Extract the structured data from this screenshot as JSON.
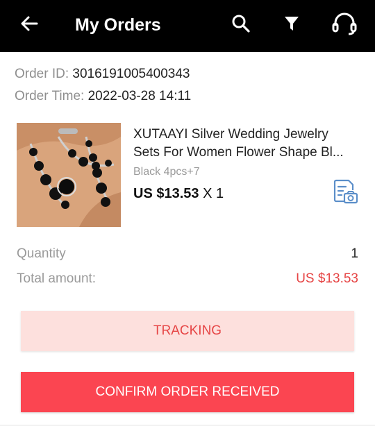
{
  "header": {
    "title": "My Orders",
    "back_icon": "arrow-left-icon",
    "actions": [
      "search-icon",
      "filter-icon",
      "headset-icon"
    ]
  },
  "order": {
    "id_label": "Order ID:",
    "id_value": "3016191005400343",
    "time_label": "Order Time:",
    "time_value": "2022-03-28 14:11"
  },
  "product": {
    "title_line1": "XUTAAYI  Silver Wedding Jewelry",
    "title_line2": "Sets For Women Flower Shape Bl...",
    "variant": "Black 4pcs+7",
    "price": "US $13.53",
    "multiplier": "X 1"
  },
  "summary": {
    "quantity_label": "Quantity",
    "quantity_value": "1",
    "total_label": "Total amount:",
    "total_value": "US $13.53"
  },
  "buttons": {
    "tracking": "TRACKING",
    "confirm": "CONFIRM ORDER RECEIVED"
  },
  "colors": {
    "accent": "#fb4551",
    "accent_text": "#e64545",
    "tracking_bg": "#fde0dd",
    "header_bg": "#000000"
  }
}
